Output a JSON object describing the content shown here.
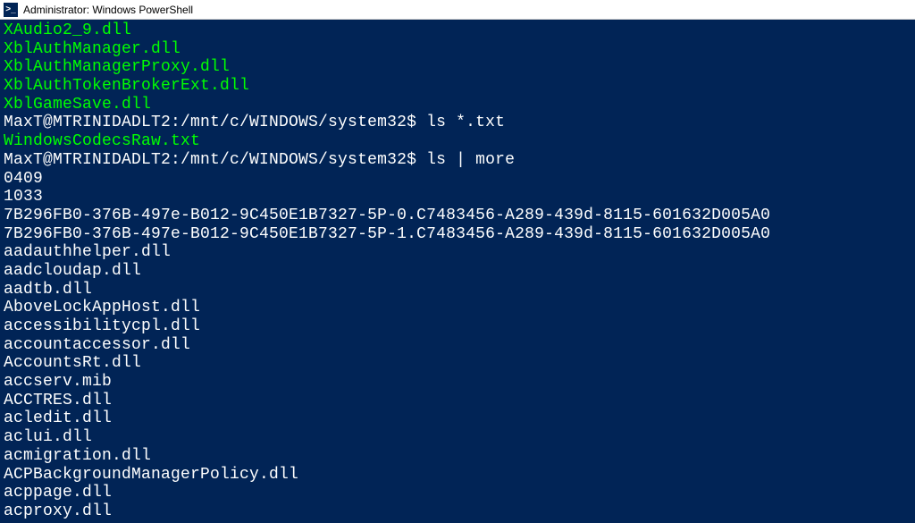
{
  "titlebar": {
    "icon_glyph": ">_",
    "title": "Administrator: Windows PowerShell"
  },
  "terminal": {
    "green_files_top": [
      "XAudio2_9.dll",
      "XblAuthManager.dll",
      "XblAuthManagerProxy.dll",
      "XblAuthTokenBrokerExt.dll",
      "XblGameSave.dll"
    ],
    "prompt1": {
      "prefix": "MaxT@MTRINIDADLT2:/mnt/c/WINDOWS/system32$ ",
      "cmd": "ls *.txt"
    },
    "txt_result": "WindowsCodecsRaw.txt",
    "prompt2": {
      "prefix": "MaxT@MTRINIDADLT2:/mnt/c/WINDOWS/system32$ ",
      "cmd": "ls | more"
    },
    "listing": [
      "0409",
      "1033",
      "7B296FB0-376B-497e-B012-9C450E1B7327-5P-0.C7483456-A289-439d-8115-601632D005A0",
      "7B296FB0-376B-497e-B012-9C450E1B7327-5P-1.C7483456-A289-439d-8115-601632D005A0",
      "aadauthhelper.dll",
      "aadcloudap.dll",
      "aadtb.dll",
      "AboveLockAppHost.dll",
      "accessibilitycpl.dll",
      "accountaccessor.dll",
      "AccountsRt.dll",
      "accserv.mib",
      "ACCTRES.dll",
      "acledit.dll",
      "aclui.dll",
      "acmigration.dll",
      "ACPBackgroundManagerPolicy.dll",
      "acppage.dll",
      "acproxy.dll"
    ]
  }
}
